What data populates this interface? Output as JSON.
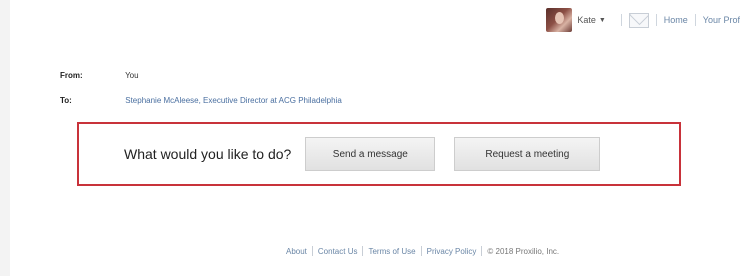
{
  "header": {
    "user_name": "Kate",
    "nav_links": [
      "Home",
      "Your Prof"
    ]
  },
  "message": {
    "from_label": "From:",
    "from_value": "You",
    "to_label": "To:",
    "to_value": "Stephanie McAleese, Executive Director at ACG Philadelphia"
  },
  "action": {
    "prompt": "What would you like to do?",
    "send_label": "Send a message",
    "meeting_label": "Request a meeting"
  },
  "footer": {
    "links": [
      "About",
      "Contact Us",
      "Terms of Use",
      "Privacy Policy"
    ],
    "copyright": "© 2018 Proxilio, Inc."
  },
  "colors": {
    "highlight_border": "#c8323a",
    "link": "#6a86a6"
  },
  "icons": [
    "avatar",
    "chevron-down-icon",
    "mail-icon"
  ]
}
